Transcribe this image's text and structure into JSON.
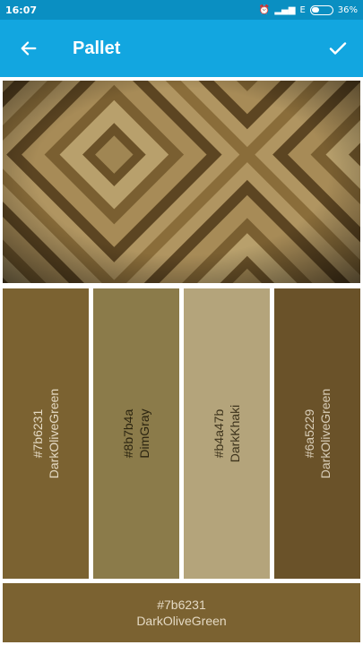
{
  "status_bar": {
    "time": "16:07",
    "network": "E",
    "battery": "36%"
  },
  "app_bar": {
    "title": "Pallet",
    "back_icon": "arrow-left-icon",
    "confirm_icon": "check-icon"
  },
  "swatches": [
    {
      "hex": "#7b6231",
      "name": "DarkOliveGreen",
      "text_color": "#e4d9c3"
    },
    {
      "hex": "#8b7b4a",
      "name": "DimGray",
      "text_color": "#2b2410"
    },
    {
      "hex": "#b4a47b",
      "name": "DarkKhaki",
      "text_color": "#3d331c"
    },
    {
      "hex": "#6a5229",
      "name": "DarkOliveGreen",
      "text_color": "#d8cdb8"
    }
  ],
  "selected": {
    "hex": "#7b6231",
    "name": "DarkOliveGreen",
    "text_color": "#e4d9c3"
  }
}
